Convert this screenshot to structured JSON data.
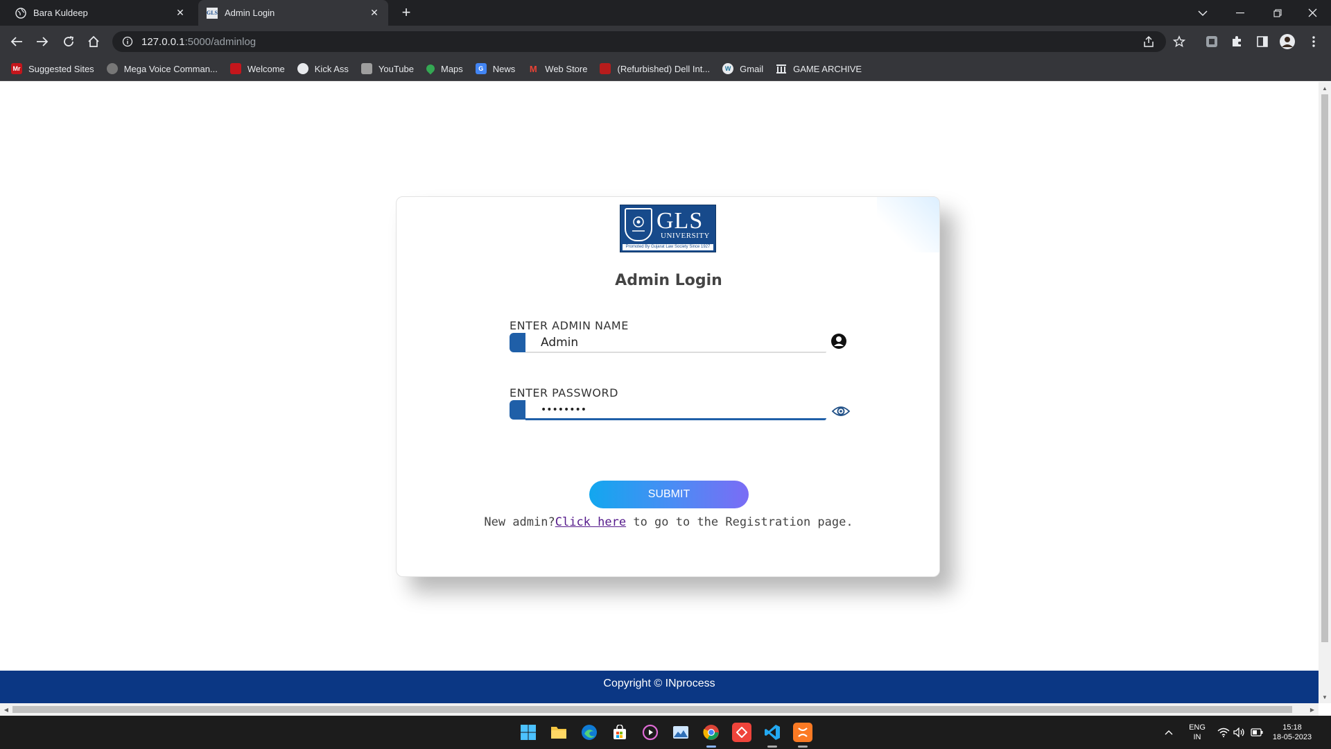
{
  "browser": {
    "tabs": [
      {
        "title": "Bara Kuldeep",
        "active": false
      },
      {
        "title": "Admin Login",
        "active": true,
        "favicon_text": "GLS"
      }
    ],
    "url_host": "127.0.0.1",
    "url_path": ":5000/adminlog",
    "bookmarks": [
      {
        "label": "Suggested Sites",
        "icon": "mr-icon",
        "icon_text": "Mr",
        "color": "#c4161c"
      },
      {
        "label": "Mega Voice Comman...",
        "icon": "voice-icon",
        "icon_text": "",
        "color": "#888888"
      },
      {
        "label": "Welcome",
        "icon": "welcome-icon",
        "icon_text": "",
        "color": "#c4161c"
      },
      {
        "label": "Kick Ass",
        "icon": "globe-icon",
        "icon_text": "",
        "color": "#e8eaed"
      },
      {
        "label": "YouTube",
        "icon": "youtube-icon",
        "icon_text": "",
        "color": "#9e9e9e"
      },
      {
        "label": "Maps",
        "icon": "maps-icon",
        "icon_text": "",
        "color": "#34a853"
      },
      {
        "label": "News",
        "icon": "news-icon",
        "icon_text": "G",
        "color": "#4285f4"
      },
      {
        "label": "Web Store",
        "icon": "gmail-icon",
        "icon_text": "M",
        "color": "#ea4335"
      },
      {
        "label": "(Refurbished) Dell Int...",
        "icon": "dell-icon",
        "icon_text": "",
        "color": "#b71c1c"
      },
      {
        "label": "Gmail",
        "icon": "wordpress-icon",
        "icon_text": "W",
        "color": "#21759b"
      },
      {
        "label": "GAME ARCHIVE",
        "icon": "archive-icon",
        "icon_text": "",
        "color": "#e8eaed"
      }
    ]
  },
  "page": {
    "logo": {
      "title": "GLS",
      "subtitle": "UNIVERSITY",
      "strip": "Promoted By Gujarat Law Society Since 1927"
    },
    "title": "Admin Login",
    "name_field": {
      "label": "ENTER ADMIN NAME",
      "value": "Admin"
    },
    "password_field": {
      "label": "ENTER PASSWORD",
      "value": "••••••••"
    },
    "submit_label": "SUBMIT",
    "register": {
      "prefix": "New admin?",
      "link": "Click here",
      "suffix": " to go to the Registration page."
    },
    "footer": "Copyright © INprocess"
  },
  "taskbar": {
    "apps": [
      "windows-start-icon",
      "file-explorer-icon",
      "edge-icon",
      "store-icon",
      "media-player-icon",
      "photos-icon",
      "chrome-icon",
      "anydesk-icon",
      "vscode-icon",
      "xampp-icon"
    ],
    "lang_line1": "ENG",
    "lang_line2": "IN",
    "time": "15:18",
    "date": "18-05-2023"
  },
  "colors": {
    "accent": "#1f5fa8",
    "footer": "#0b3784",
    "button_start": "#12a7ef",
    "button_end": "#7b6cf5"
  }
}
